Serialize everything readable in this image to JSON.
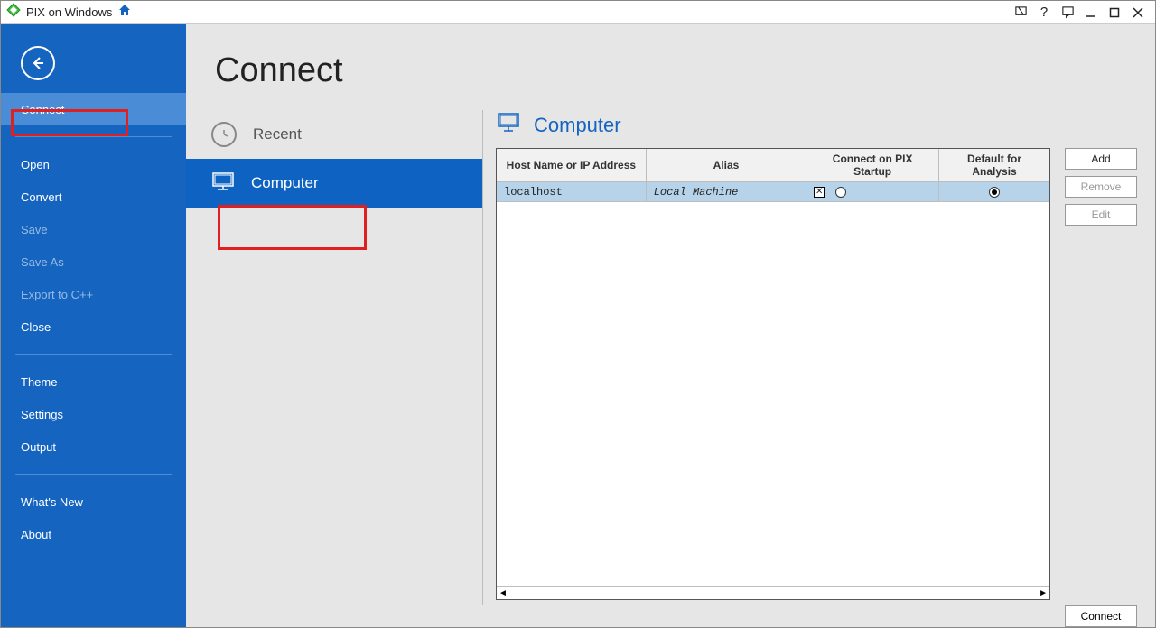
{
  "titlebar": {
    "title": "PIX on Windows"
  },
  "sidebar": {
    "items": [
      {
        "label": "Connect",
        "selected": true,
        "dim": false
      },
      {
        "label": "Open",
        "dim": false
      },
      {
        "label": "Convert",
        "dim": false
      },
      {
        "label": "Save",
        "dim": true
      },
      {
        "label": "Save As",
        "dim": true
      },
      {
        "label": "Export to C++",
        "dim": true
      },
      {
        "label": "Close",
        "dim": false
      },
      {
        "label": "Theme",
        "dim": false
      },
      {
        "label": "Settings",
        "dim": false
      },
      {
        "label": "Output",
        "dim": false
      },
      {
        "label": "What's New",
        "dim": false
      },
      {
        "label": "About",
        "dim": false
      }
    ]
  },
  "page": {
    "title": "Connect"
  },
  "nav": {
    "recent_label": "Recent",
    "computer_label": "Computer"
  },
  "section": {
    "heading": "Computer"
  },
  "table": {
    "headers": {
      "host": "Host Name or IP Address",
      "alias": "Alias",
      "startup": "Connect on PIX Startup",
      "default": "Default for Analysis"
    },
    "rows": [
      {
        "host": "localhost",
        "alias": "Local Machine",
        "startup_checked": true,
        "startup_radio": false,
        "default_radio": true
      }
    ]
  },
  "buttons": {
    "add": "Add",
    "remove": "Remove",
    "edit": "Edit",
    "connect": "Connect"
  }
}
